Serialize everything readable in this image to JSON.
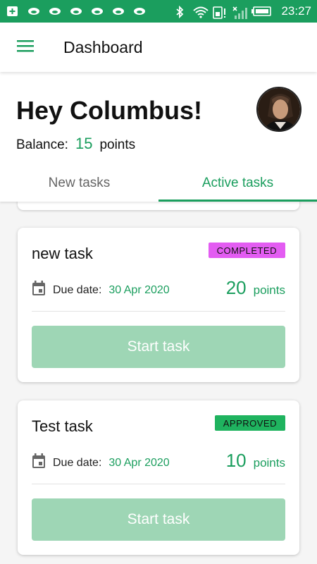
{
  "status_bar": {
    "time": "23:27",
    "icons": [
      "add-box-icon",
      "notification-icon",
      "notification-icon",
      "notification-icon",
      "notification-icon",
      "notification-icon",
      "notification-icon",
      "bluetooth-icon",
      "wifi-icon",
      "sim-icon",
      "signal-icon",
      "battery-icon"
    ]
  },
  "app_bar": {
    "title": "Dashboard",
    "menu_icon": "menu-icon"
  },
  "header": {
    "greeting": "Hey Columbus!",
    "balance_label": "Balance:",
    "balance_value": "15",
    "balance_unit": "points"
  },
  "tabs": [
    {
      "label": "New tasks",
      "active": false
    },
    {
      "label": "Active tasks",
      "active": true
    }
  ],
  "tasks": [
    {
      "title": "new task",
      "status": "COMPLETED",
      "status_color": "#e35cf2",
      "due_label": "Due date:",
      "due_date": "30 Apr 2020",
      "points": "20",
      "points_label": "points",
      "button_label": "Start task"
    },
    {
      "title": "Test task",
      "status": "APPROVED",
      "status_color": "#1fb35f",
      "due_label": "Due date:",
      "due_date": "30 Apr 2020",
      "points": "10",
      "points_label": "points",
      "button_label": "Start task"
    }
  ],
  "colors": {
    "accent": "#1b9e5e",
    "button_disabled": "#9ed6b5"
  }
}
